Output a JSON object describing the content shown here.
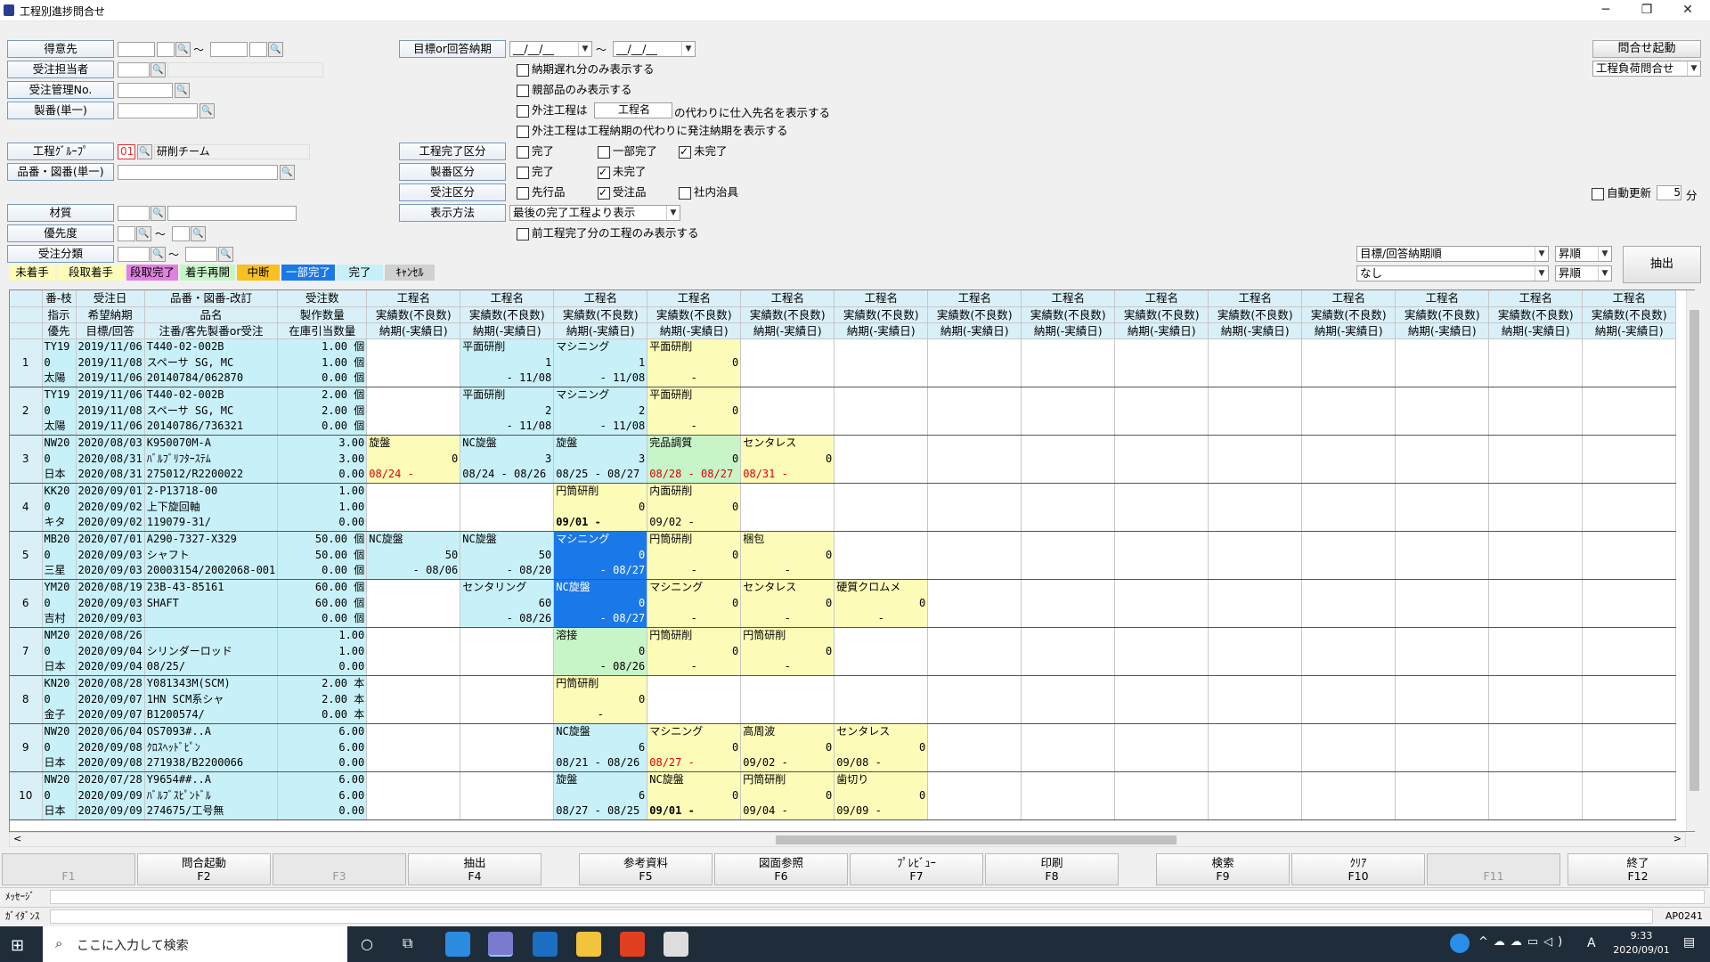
{
  "window": {
    "title": "工程別進捗問合せ"
  },
  "form": {
    "tokuisaki": "得意先",
    "juchu_tanto": "受注担当者",
    "juchu_kanri": "受注管理No.",
    "seiban": "製番(単一)",
    "koutei_group": "工程ｸﾞﾙｰﾌﾟ",
    "koutei_group_code": "01",
    "koutei_group_name": "研削チーム",
    "hinban": "品番・図番(単一)",
    "zaishitsu": "材質",
    "yusendo": "優先度",
    "juchu_bunrui": "受注分類",
    "mokuhyo_label": "目標or回答納期",
    "date_ph": "__/__/__",
    "tilde": "～",
    "cb_late": "納期遅れ分のみ表示する",
    "cb_parent": "親部品のみ表示する",
    "cb_gaichu_a": "外注工程は",
    "koutei_mei": "工程名",
    "cb_gaichu_b": "の代わりに仕入先名を表示する",
    "cb_gaichu2": "外注工程は工程納期の代わりに発注納期を表示する",
    "kanryo_label": "工程完了区分",
    "kanryo": [
      "完了",
      "一部完了",
      "未完了"
    ],
    "seiban_label": "製番区分",
    "seiban_kubun": [
      "完了",
      "未完了"
    ],
    "juchu_label": "受注区分",
    "juchu_kubun": [
      "先行品",
      "受注品",
      "社内治具"
    ],
    "hyoji_label": "表示方法",
    "hyoji": "最後の完了工程より表示",
    "cb_mae": "前工程完了分の工程のみ表示する",
    "auto_label": "自動更新",
    "auto_val": "5",
    "auto_unit": "分",
    "toiawase_btn": "問合せ起動",
    "toiawase_sel": "工程負荷問合せ",
    "sort1": "目標/回答納期順",
    "sort2": "なし",
    "order1": "昇順",
    "order2": "昇順",
    "extract": "抽出"
  },
  "legend": [
    {
      "label": "未着手",
      "bg": "#fcfcb8"
    },
    {
      "label": "段取着手",
      "bg": "#fcfcb8"
    },
    {
      "label": "段取完了",
      "bg": "#e080e0"
    },
    {
      "label": "着手再開",
      "bg": "#c8f5c8"
    },
    {
      "label": "中断",
      "bg": "#f8c020"
    },
    {
      "label": "一部完了",
      "bg": "#1a78e8"
    },
    {
      "label": "完了",
      "bg": "#c8f0f8"
    },
    {
      "label": "ｷｬﾝｾﾙ",
      "bg": "#d0d0d0"
    }
  ],
  "grid": {
    "h1": [
      "番-枝",
      "受注日",
      "品番・図番-改訂",
      "受注数"
    ],
    "h2": [
      "指示",
      "希望納期",
      "品名",
      "製作数量"
    ],
    "h3": [
      "優先",
      "目標/回答",
      "注番/客先製番or受注",
      "在庫引当数量"
    ],
    "proc_h1": "工程名",
    "proc_h2": "実績数(不良数)",
    "proc_h3": "納期(-実績日)",
    "rows": [
      {
        "no": "1",
        "a": [
          "TY19",
          "0",
          "太陽"
        ],
        "b": [
          "2019/11/06",
          "2019/11/08",
          "2019/11/06"
        ],
        "c": [
          "T440-02-002B",
          "スペーサ SG, MC",
          "20140784/062870"
        ],
        "d": [
          "1.00 個",
          "1.00 個",
          "0.00 個"
        ],
        "p": [
          [
            null,
            null,
            null
          ],
          [
            [
              "平面研削",
              "1",
              "- 11/08"
            ],
            "g"
          ],
          [
            [
              "マシニング",
              "1",
              "- 11/08"
            ],
            "g"
          ],
          [
            [
              "平面研削",
              "0",
              "-"
            ],
            "y"
          ]
        ]
      },
      {
        "no": "2",
        "a": [
          "TY19",
          "0",
          "太陽"
        ],
        "b": [
          "2019/11/06",
          "2019/11/08",
          "2019/11/06"
        ],
        "c": [
          "T440-02-002B",
          "スペーサ SG, MC",
          "20140786/736321"
        ],
        "d": [
          "2.00 個",
          "2.00 個",
          "0.00 個"
        ],
        "p": [
          [
            null,
            null,
            null
          ],
          [
            [
              "平面研削",
              "2",
              "- 11/08"
            ],
            "g"
          ],
          [
            [
              "マシニング",
              "2",
              "- 11/08"
            ],
            "g"
          ],
          [
            [
              "平面研削",
              "0",
              "-"
            ],
            "y"
          ]
        ]
      },
      {
        "no": "3",
        "a": [
          "NW20",
          "0",
          "日本"
        ],
        "b": [
          "2020/08/03",
          "2020/08/31",
          "2020/08/31"
        ],
        "c": [
          "K950070M-A",
          "ﾊﾞﾙﾌﾞﾘﾌﾀｰｽﾃﾑ",
          "275012/R2200022"
        ],
        "d": [
          "3.00",
          "3.00",
          "0.00"
        ],
        "p": [
          [
            [
              "旋盤",
              "0",
              "08/24 -"
            ],
            "y",
            "r3"
          ],
          [
            [
              "NC旋盤",
              "3",
              "08/24 - 08/26"
            ],
            "g"
          ],
          [
            [
              "旋盤",
              "3",
              "08/25 - 08/27"
            ],
            "g"
          ],
          [
            [
              "完品調質",
              "0",
              "08/28 - 08/27"
            ],
            "gr",
            "r3"
          ],
          [
            [
              "センタレス",
              "0",
              "08/31 -"
            ],
            "y",
            "r3"
          ]
        ]
      },
      {
        "no": "4",
        "a": [
          "KK20",
          "0",
          "キタ"
        ],
        "b": [
          "2020/09/01",
          "2020/09/02",
          "2020/09/02"
        ],
        "c": [
          "2-P13718-00",
          "上下旋回軸",
          "119079-31/"
        ],
        "d": [
          "1.00",
          "1.00",
          "0.00"
        ],
        "p": [
          [
            null,
            null,
            null
          ],
          [
            null,
            null,
            null
          ],
          [
            [
              "円筒研削",
              "0",
              "09/01 -"
            ],
            "y",
            "b3"
          ],
          [
            [
              "内面研削",
              "0",
              "09/02 -"
            ],
            "y"
          ]
        ]
      },
      {
        "no": "5",
        "a": [
          "MB20",
          "0",
          "三星"
        ],
        "b": [
          "2020/07/01",
          "2020/09/03",
          "2020/09/03"
        ],
        "c": [
          "A290-7327-X329",
          "シャフト",
          "20003154/2002068-001"
        ],
        "d": [
          "50.00 個",
          "50.00 個",
          "0.00 個"
        ],
        "p": [
          [
            [
              "NC旋盤",
              "50",
              "- 08/06"
            ],
            "g"
          ],
          [
            [
              "NC旋盤",
              "50",
              "- 08/20"
            ],
            "g"
          ],
          [
            [
              "マシニング",
              "0",
              "- 08/27"
            ],
            "b"
          ],
          [
            [
              "円筒研削",
              "0",
              "-"
            ],
            "y"
          ],
          [
            [
              "梱包",
              "0",
              "-"
            ],
            "y"
          ]
        ]
      },
      {
        "no": "6",
        "a": [
          "YM20",
          "0",
          "吉村"
        ],
        "b": [
          "2020/08/19",
          "2020/09/03",
          "2020/09/03"
        ],
        "c": [
          "23B-43-85161",
          "SHAFT",
          ""
        ],
        "d": [
          "60.00 個",
          "60.00 個",
          "0.00 個"
        ],
        "p": [
          [
            null,
            null,
            null
          ],
          [
            [
              "センタリング",
              "60",
              "- 08/26"
            ],
            "g"
          ],
          [
            [
              "NC旋盤",
              "0",
              "- 08/27"
            ],
            "b"
          ],
          [
            [
              "マシニング",
              "0",
              "-"
            ],
            "y"
          ],
          [
            [
              "センタレス",
              "0",
              "-"
            ],
            "y"
          ],
          [
            [
              "硬質クロムメ",
              "0",
              "-"
            ],
            "y"
          ]
        ]
      },
      {
        "no": "7",
        "a": [
          "NM20",
          "0",
          "日本"
        ],
        "b": [
          "2020/08/26",
          "2020/09/04",
          "2020/09/04"
        ],
        "c": [
          "",
          "シリンダーロッド",
          "08/25/"
        ],
        "d": [
          "1.00",
          "1.00",
          "0.00"
        ],
        "p": [
          [
            null,
            null,
            null
          ],
          [
            null,
            null,
            null
          ],
          [
            [
              "溶接",
              "0",
              "- 08/26"
            ],
            "gr"
          ],
          [
            [
              "円筒研削",
              "0",
              "-"
            ],
            "y"
          ],
          [
            [
              "円筒研削",
              "0",
              "-"
            ],
            "y"
          ]
        ]
      },
      {
        "no": "8",
        "a": [
          "KN20",
          "0",
          "金子"
        ],
        "b": [
          "2020/08/28",
          "2020/09/07",
          "2020/09/07"
        ],
        "c": [
          "Y081343M(SCM)",
          "1HN SCM系シャ",
          "B1200574/"
        ],
        "d": [
          "2.00 本",
          "2.00 本",
          "0.00 本"
        ],
        "p": [
          [
            null,
            null,
            null
          ],
          [
            null,
            null,
            null
          ],
          [
            [
              "円筒研削",
              "0",
              "-"
            ],
            "y"
          ]
        ]
      },
      {
        "no": "9",
        "a": [
          "NW20",
          "0",
          "日本"
        ],
        "b": [
          "2020/06/04",
          "2020/09/08",
          "2020/09/08"
        ],
        "c": [
          "OS7093#..A",
          "ｸﾛｽﾍｯﾄﾞﾋﾟﾝ",
          "271938/B2200066"
        ],
        "d": [
          "6.00",
          "6.00",
          "0.00"
        ],
        "p": [
          [
            null,
            null,
            null
          ],
          [
            null,
            null,
            null
          ],
          [
            [
              "NC旋盤",
              "6",
              "08/21 - 08/26"
            ],
            "g"
          ],
          [
            [
              "マシニング",
              "0",
              "08/27 -"
            ],
            "y",
            "r3"
          ],
          [
            [
              "高周波",
              "0",
              "09/02 -"
            ],
            "y"
          ],
          [
            [
              "センタレス",
              "0",
              "09/08 -"
            ],
            "y"
          ]
        ]
      },
      {
        "no": "10",
        "a": [
          "NW20",
          "0",
          "日本"
        ],
        "b": [
          "2020/07/28",
          "2020/09/09",
          "2020/09/09"
        ],
        "c": [
          "Y9654##..A",
          "ﾊﾞﾙﾌﾞｽﾋﾟﾝﾄﾞﾙ",
          "274675/工号無"
        ],
        "d": [
          "6.00",
          "6.00",
          "0.00"
        ],
        "p": [
          [
            null,
            null,
            null
          ],
          [
            null,
            null,
            null
          ],
          [
            [
              "旋盤",
              "6",
              "08/27 - 08/25"
            ],
            "g"
          ],
          [
            [
              "NC旋盤",
              "0",
              "09/01 -"
            ],
            "y",
            "b3"
          ],
          [
            [
              "円筒研削",
              "0",
              "09/04 -"
            ],
            "y"
          ],
          [
            [
              "歯切り",
              "0",
              "09/09 -"
            ],
            "y"
          ]
        ]
      }
    ]
  },
  "fkeys": [
    {
      "t": "",
      "k": "F1",
      "dis": true
    },
    {
      "t": "問合起動",
      "k": "F2"
    },
    {
      "t": "",
      "k": "F3",
      "dis": true
    },
    {
      "t": "抽出",
      "k": "F4"
    },
    {
      "t": "参考資料",
      "k": "F5"
    },
    {
      "t": "図面参照",
      "k": "F6"
    },
    {
      "t": "ﾌﾟﾚﾋﾞｭｰ",
      "k": "F7"
    },
    {
      "t": "印刷",
      "k": "F8"
    },
    {
      "t": "検索",
      "k": "F9"
    },
    {
      "t": "ｸﾘｱ",
      "k": "F10"
    },
    {
      "t": "",
      "k": "F11",
      "dis": true
    },
    {
      "t": "終了",
      "k": "F12"
    }
  ],
  "status": {
    "msg_label": "ﾒｯｾｰｼﾞ",
    "guide_label": "ｶﾞｲﾀﾞﾝｽ",
    "screen_id": "AP0241"
  },
  "taskbar": {
    "search": "ここに入力して検索",
    "time": "9:33",
    "date": "2020/09/01",
    "lang": "A"
  }
}
